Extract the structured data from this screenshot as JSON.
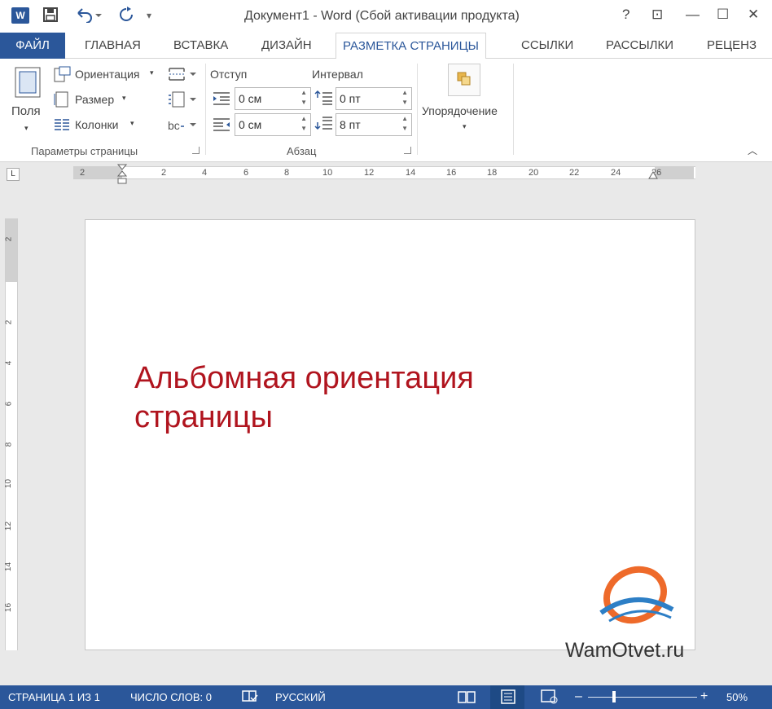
{
  "window": {
    "title": "Документ1 - Word (Сбой активации продукта)",
    "logo": "W",
    "controls": {
      "help": "?",
      "ribbon_display": "⊡",
      "minimize": "—",
      "maximize": "☐",
      "close": "✕"
    }
  },
  "tabs": [
    {
      "label": "ФАЙЛ"
    },
    {
      "label": "ГЛАВНАЯ"
    },
    {
      "label": "ВСТАВКА"
    },
    {
      "label": "ДИЗАЙН"
    },
    {
      "label": "РАЗМЕТКА СТРАНИЦЫ"
    },
    {
      "label": "ССЫЛКИ"
    },
    {
      "label": "РАССЫЛКИ"
    },
    {
      "label": "РЕЦЕНЗ"
    }
  ],
  "ribbon": {
    "page_setup": {
      "fields_label": "Поля",
      "orientation_label": "Ориентация",
      "size_label": "Размер",
      "columns_label": "Колонки",
      "group_label": "Параметры страницы"
    },
    "paragraph": {
      "indent_label": "Отступ",
      "spacing_label": "Интервал",
      "indent_left_value": "0 см",
      "indent_right_value": "0 см",
      "spacing_before_value": "0 пт",
      "spacing_after_value": "8 пт",
      "group_label": "Абзац"
    },
    "arrange": {
      "label": "Упорядочение"
    }
  },
  "ruler": {
    "corner": "L",
    "h_ticks": [
      "2",
      "2",
      "4",
      "6",
      "8",
      "10",
      "12",
      "14",
      "16",
      "18",
      "20",
      "22",
      "24",
      "26"
    ],
    "v_ticks": [
      "2",
      "2",
      "4",
      "6",
      "8",
      "10",
      "12",
      "14",
      "16"
    ]
  },
  "document": {
    "heading_line1": "Альбомная ориентация",
    "heading_line2": "страницы",
    "heading_color": "#b0141e"
  },
  "watermark": {
    "text": "WamOtvet.ru"
  },
  "statusbar": {
    "page": "СТРАНИЦА 1 ИЗ 1",
    "words": "ЧИСЛО СЛОВ: 0",
    "language": "РУССКИЙ",
    "zoom_minus": "–",
    "zoom_plus": "+",
    "zoom": "50%"
  },
  "colors": {
    "accent": "#2b579a",
    "heading": "#b0141e"
  }
}
